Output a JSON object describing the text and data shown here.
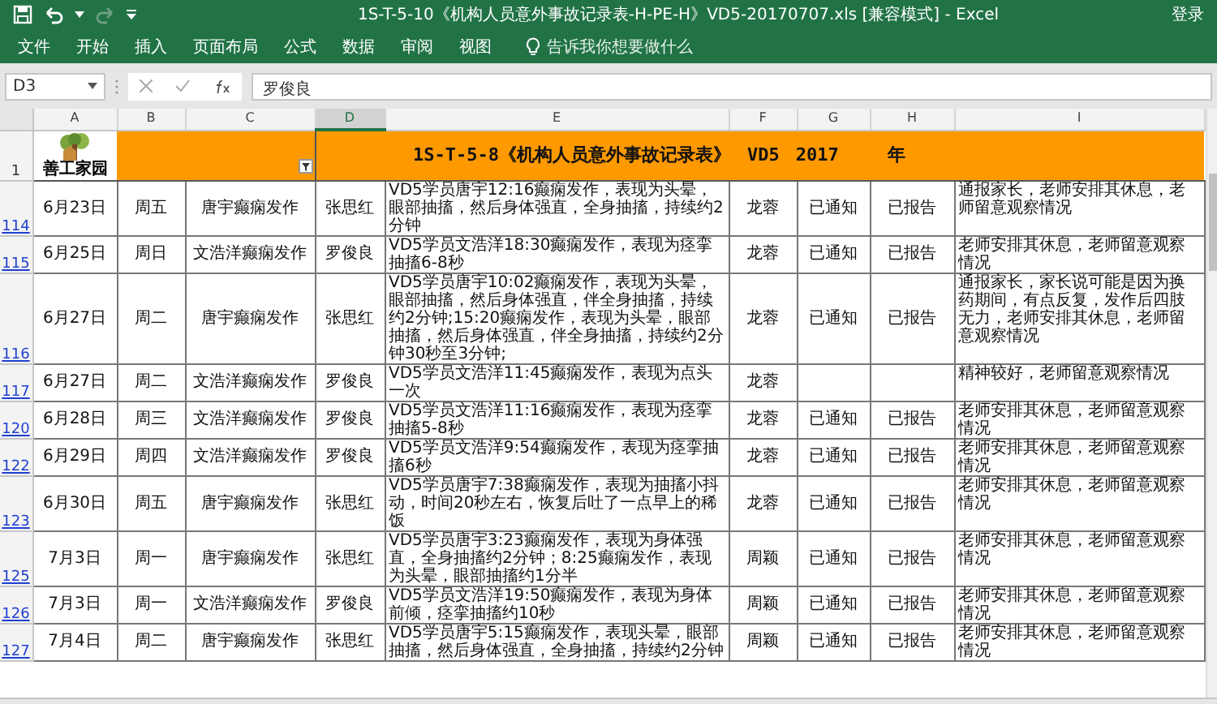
{
  "window": {
    "title": "1S-T-5-10《机构人员意外事故记录表-H-PE-H》VD5-20170707.xls  [兼容模式] - Excel",
    "account": "登录"
  },
  "ribbon": {
    "tabs": [
      "文件",
      "开始",
      "插入",
      "页面布局",
      "公式",
      "数据",
      "审阅",
      "视图"
    ],
    "tell_me": "告诉我你想要做什么"
  },
  "formula_bar": {
    "name_box": "D3",
    "value": "罗俊良"
  },
  "columns": [
    {
      "label": "A",
      "selected": false
    },
    {
      "label": "B",
      "selected": false
    },
    {
      "label": "C",
      "selected": false
    },
    {
      "label": "D",
      "selected": true
    },
    {
      "label": "E",
      "selected": false
    },
    {
      "label": "F",
      "selected": false
    },
    {
      "label": "G",
      "selected": false
    },
    {
      "label": "H",
      "selected": false
    },
    {
      "label": "I",
      "selected": false
    }
  ],
  "title_row": {
    "row_number": "1",
    "logo_text": "善工家园",
    "title_parts": [
      "1S-T-5-8《机构人员意外事故记录表》",
      "VD5",
      "2017",
      "年"
    ]
  },
  "rows": [
    {
      "row_number": "114",
      "cells": [
        "6月23日",
        "周五",
        "唐宇癫痫发作",
        "张思红",
        "VD5学员唐宇12:16癫痫发作，表现为头晕，眼部抽搐，然后身体强直，全身抽搐，持续约2分钟",
        "龙蓉",
        "已通知",
        "已报告",
        "通报家长，老师安排其休息，老师留意观察情况"
      ]
    },
    {
      "row_number": "115",
      "cells": [
        "6月25日",
        "周日",
        "文浩洋癫痫发作",
        "罗俊良",
        "VD5学员文浩洋18:30癫痫发作，表现为痉挛抽搐6-8秒",
        "龙蓉",
        "已通知",
        "已报告",
        "老师安排其休息，老师留意观察情况"
      ]
    },
    {
      "row_number": "116",
      "cells": [
        "6月27日",
        "周二",
        "唐宇癫痫发作",
        "张思红",
        "VD5学员唐宇10:02癫痫发作，表现为头晕，眼部抽搐，然后身体强直，伴全身抽搐，持续约2分钟;15:20癫痫发作，表现为头晕，眼部抽搐，然后身体强直，伴全身抽搐，持续约2分钟30秒至3分钟;",
        "龙蓉",
        "已通知",
        "已报告",
        "通报家长，家长说可能是因为换药期间，有点反复，发作后四肢无力，老师安排其休息，老师留意观察情况"
      ]
    },
    {
      "row_number": "117",
      "cells": [
        "6月27日",
        "周二",
        "文浩洋癫痫发作",
        "罗俊良",
        "VD5学员文浩洋11:45癫痫发作，表现为点头一次",
        "龙蓉",
        null,
        null,
        "精神较好，老师留意观察情况"
      ]
    },
    {
      "row_number": "120",
      "cells": [
        "6月28日",
        "周三",
        "文浩洋癫痫发作",
        "罗俊良",
        "VD5学员文浩洋11:16癫痫发作，表现为痉挛抽搐5-8秒",
        "龙蓉",
        "已通知",
        "已报告",
        "老师安排其休息，老师留意观察情况"
      ]
    },
    {
      "row_number": "122",
      "cells": [
        "6月29日",
        "周四",
        "文浩洋癫痫发作",
        "罗俊良",
        "VD5学员文浩洋9:54癫痫发作，表现为痉挛抽搐6秒",
        "龙蓉",
        "已通知",
        "已报告",
        "老师安排其休息，老师留意观察情况"
      ]
    },
    {
      "row_number": "123",
      "cells": [
        "6月30日",
        "周五",
        "唐宇癫痫发作",
        "张思红",
        "VD5学员唐宇7:38癫痫发作，表现为抽搐小抖动，时间20秒左右，恢复后吐了一点早上的稀饭",
        "龙蓉",
        "已通知",
        "已报告",
        "老师安排其休息，老师留意观察情况"
      ]
    },
    {
      "row_number": "125",
      "cells": [
        "7月3日",
        "周一",
        "唐宇癫痫发作",
        "张思红",
        "VD5学员唐宇3:23癫痫发作，表现为身体强直，全身抽搐约2分钟；8:25癫痫发作，表现为头晕，眼部抽搐约1分半",
        "周颖",
        "已通知",
        "已报告",
        "老师安排其休息，老师留意观察情况"
      ]
    },
    {
      "row_number": "126",
      "cells": [
        "7月3日",
        "周一",
        "文浩洋癫痫发作",
        "罗俊良",
        "VD5学员文浩洋19:50癫痫发作，表现为身体前倾，痉挛抽搐约10秒",
        "周颖",
        "已通知",
        "已报告",
        "老师安排其休息，老师留意观察情况"
      ]
    },
    {
      "row_number": "127",
      "cells": [
        "7月4日",
        "周二",
        "唐宇癫痫发作",
        "张思红",
        "VD5学员唐宇5:15癫痫发作，表现头晕，眼部抽搐，然后身体强直，全身抽搐，持续约2分钟",
        "周颖",
        "已通知",
        "已报告",
        "老师安排其休息，老师留意观察情况"
      ]
    }
  ]
}
